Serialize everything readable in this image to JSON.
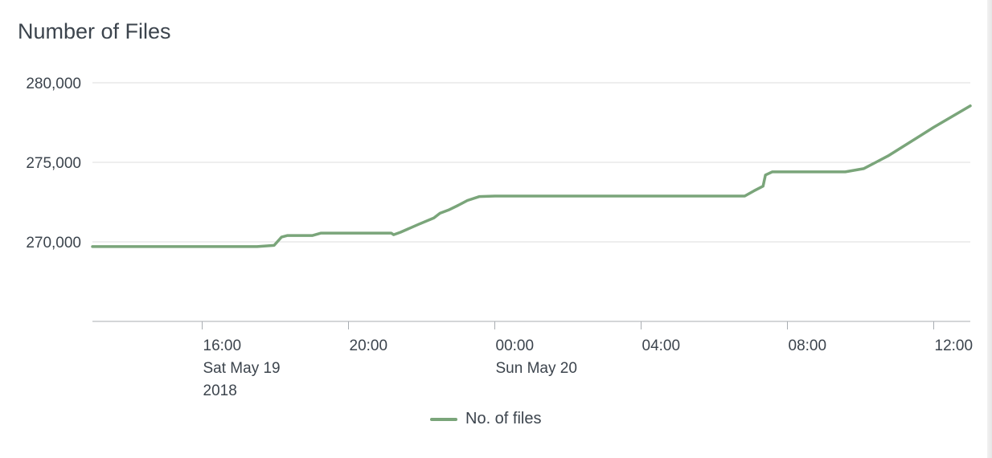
{
  "panel": {
    "title": "Number of Files"
  },
  "chart_data": {
    "type": "line",
    "title": "Number of Files",
    "xlabel": "",
    "ylabel": "",
    "ylim": [
      265000,
      280000
    ],
    "y_ticks": [
      270000,
      275000,
      280000
    ],
    "y_tick_labels": [
      "270,000",
      "275,000",
      "280,000"
    ],
    "x_range": [
      "2018-05-19T13:00",
      "2018-05-20T13:00"
    ],
    "x_ticks": [
      {
        "x": "2018-05-19T16:00",
        "lines": [
          "16:00",
          "Sat May 19",
          "2018"
        ]
      },
      {
        "x": "2018-05-19T20:00",
        "lines": [
          "20:00"
        ]
      },
      {
        "x": "2018-05-20T00:00",
        "lines": [
          "00:00",
          "Sun May 20"
        ]
      },
      {
        "x": "2018-05-20T04:00",
        "lines": [
          "04:00"
        ]
      },
      {
        "x": "2018-05-20T08:00",
        "lines": [
          "08:00"
        ]
      },
      {
        "x": "2018-05-20T12:00",
        "lines": [
          "12:00"
        ]
      }
    ],
    "grid": true,
    "legend_position": "bottom-center",
    "series": [
      {
        "name": "No. of files",
        "color": "#7aa57a",
        "points": [
          {
            "x": "2018-05-19T13:00",
            "y": 269700
          },
          {
            "x": "2018-05-19T17:30",
            "y": 269700
          },
          {
            "x": "2018-05-19T17:58",
            "y": 269780
          },
          {
            "x": "2018-05-19T18:10",
            "y": 270300
          },
          {
            "x": "2018-05-19T18:20",
            "y": 270400
          },
          {
            "x": "2018-05-19T19:01",
            "y": 270400
          },
          {
            "x": "2018-05-19T19:15",
            "y": 270550
          },
          {
            "x": "2018-05-19T20:00",
            "y": 270550
          },
          {
            "x": "2018-05-19T20:40",
            "y": 270550
          },
          {
            "x": "2018-05-19T21:10",
            "y": 270550
          },
          {
            "x": "2018-05-19T21:14",
            "y": 270450
          },
          {
            "x": "2018-05-19T21:25",
            "y": 270600
          },
          {
            "x": "2018-05-19T21:55",
            "y": 271100
          },
          {
            "x": "2018-05-19T22:20",
            "y": 271500
          },
          {
            "x": "2018-05-19T22:30",
            "y": 271800
          },
          {
            "x": "2018-05-19T22:44",
            "y": 272000
          },
          {
            "x": "2018-05-19T23:00",
            "y": 272300
          },
          {
            "x": "2018-05-19T23:15",
            "y": 272600
          },
          {
            "x": "2018-05-19T23:35",
            "y": 272850
          },
          {
            "x": "2018-05-20T00:00",
            "y": 272880
          },
          {
            "x": "2018-05-20T04:00",
            "y": 272880
          },
          {
            "x": "2018-05-20T06:50",
            "y": 272880
          },
          {
            "x": "2018-05-20T07:05",
            "y": 273200
          },
          {
            "x": "2018-05-20T07:20",
            "y": 273500
          },
          {
            "x": "2018-05-20T07:24",
            "y": 274200
          },
          {
            "x": "2018-05-20T07:35",
            "y": 274400
          },
          {
            "x": "2018-05-20T08:00",
            "y": 274400
          },
          {
            "x": "2018-05-20T09:35",
            "y": 274400
          },
          {
            "x": "2018-05-20T10:05",
            "y": 274600
          },
          {
            "x": "2018-05-20T10:25",
            "y": 275000
          },
          {
            "x": "2018-05-20T10:45",
            "y": 275400
          },
          {
            "x": "2018-05-20T12:00",
            "y": 277200
          },
          {
            "x": "2018-05-20T13:00",
            "y": 278550
          }
        ]
      }
    ]
  }
}
